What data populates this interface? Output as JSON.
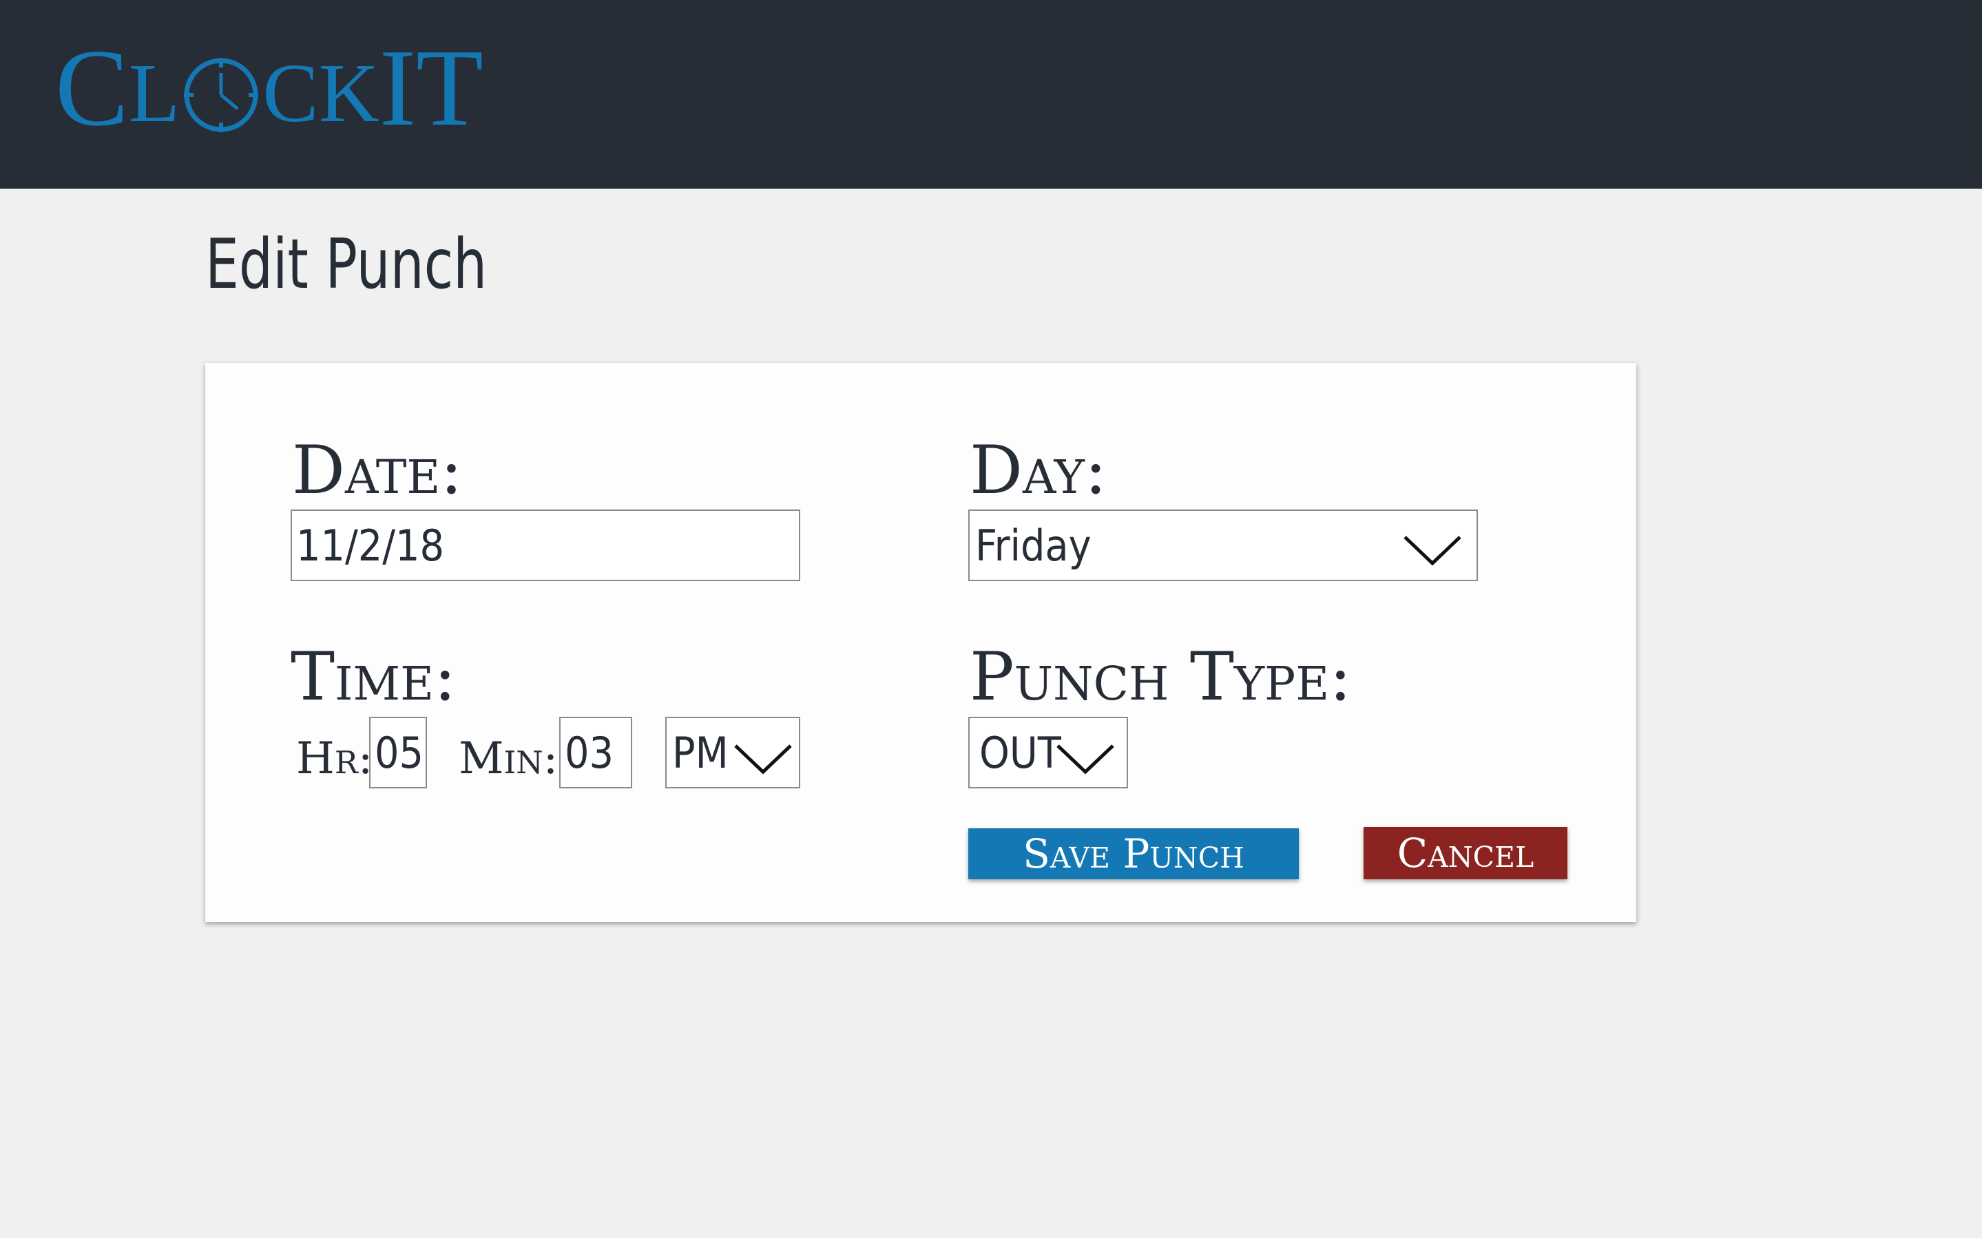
{
  "header": {
    "logo": {
      "part1": "C",
      "part2": "L",
      "part3": "CK",
      "part4": "IT"
    },
    "colors": {
      "bar": "#272d36",
      "brand": "#1478b4"
    }
  },
  "page": {
    "title": "Edit Punch"
  },
  "form": {
    "date": {
      "label": "Date:",
      "value": "11/2/18"
    },
    "day": {
      "label": "Day:",
      "value": "Friday",
      "icon": "chevron-down-icon"
    },
    "time": {
      "label": "Time:",
      "hr_label": "Hr:",
      "hr_value": "05",
      "min_label": "Min:",
      "min_value": "03",
      "ampm_value": "PM"
    },
    "punch_type": {
      "label": "Punch Type:",
      "value": "OUT"
    }
  },
  "buttons": {
    "save_label": "Save Punch",
    "cancel_label": "Cancel",
    "colors": {
      "save": "#1478b4",
      "cancel": "#8b2420"
    }
  }
}
